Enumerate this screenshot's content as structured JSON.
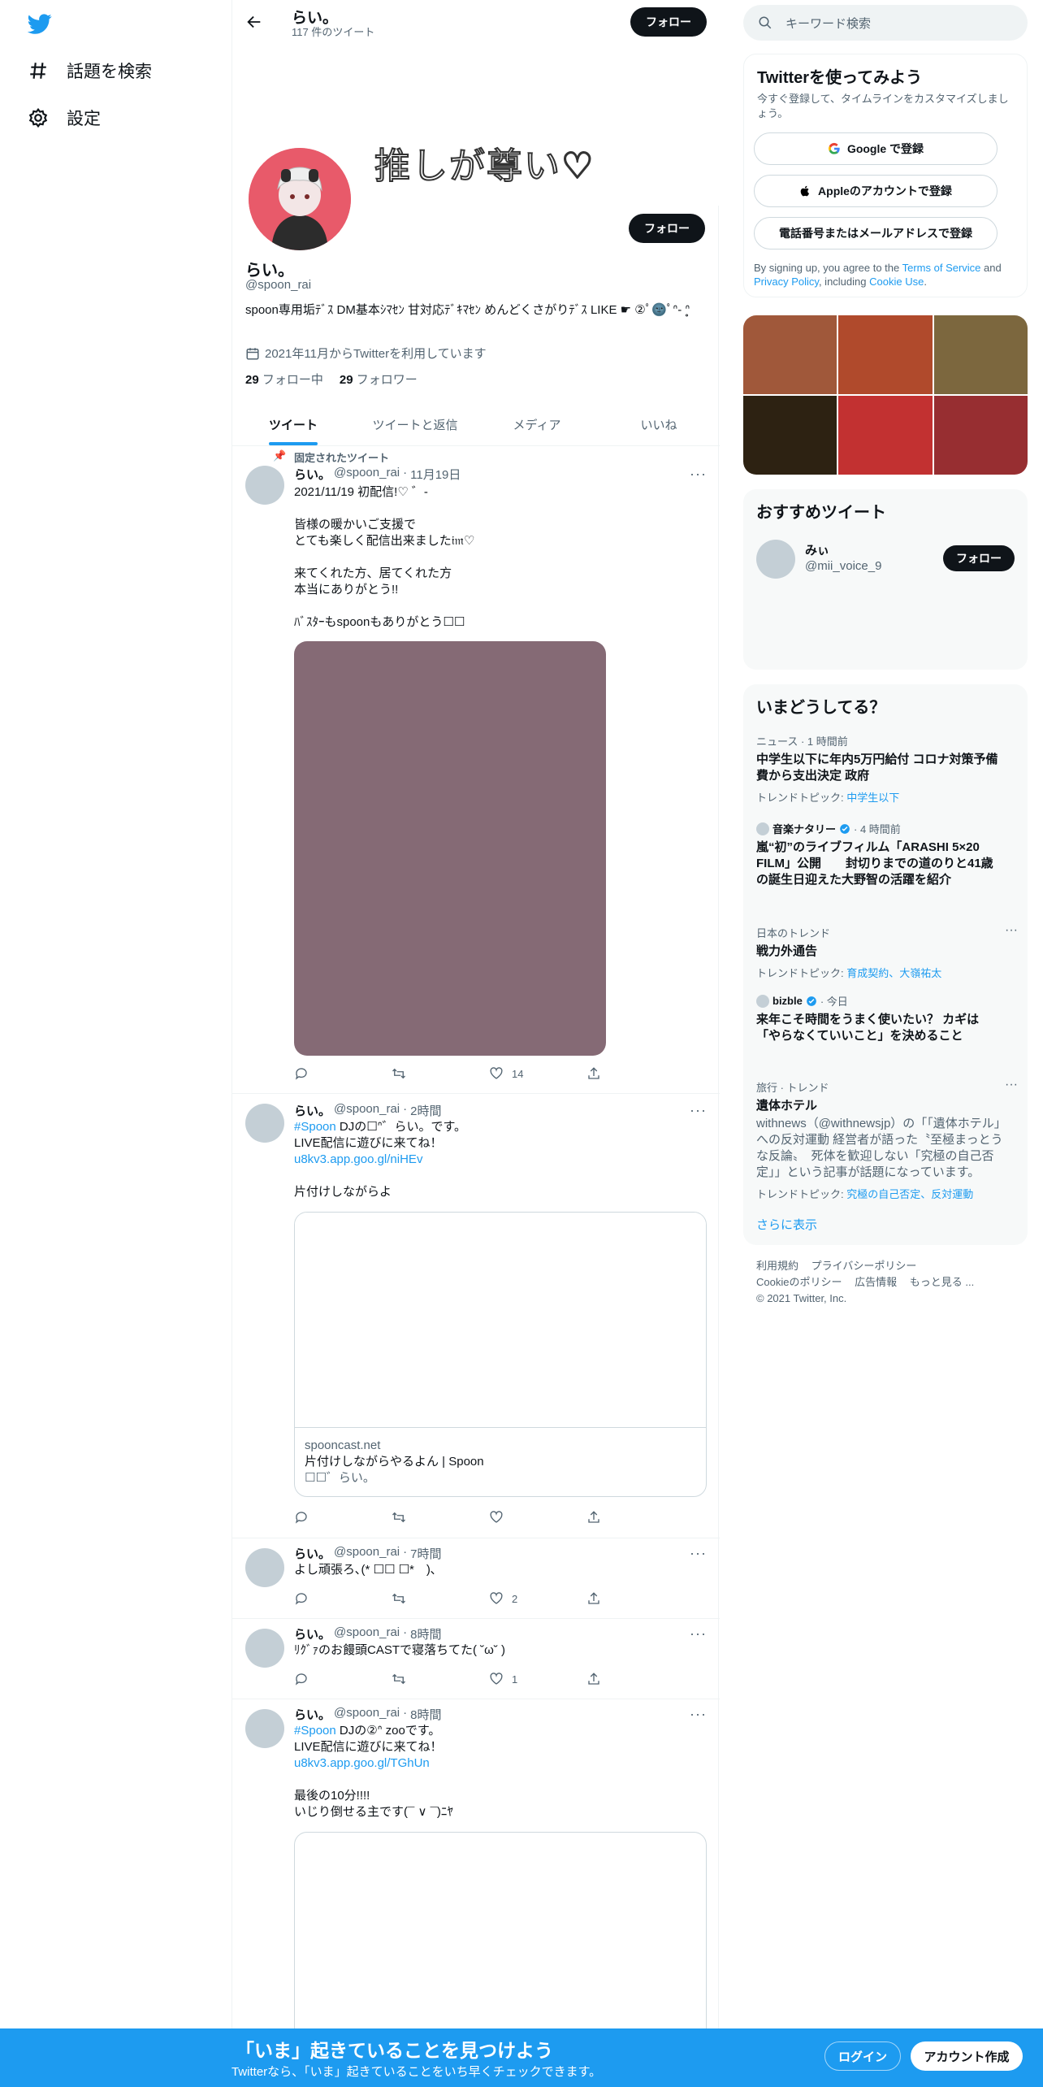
{
  "nav": {
    "explore_label": "話題を検索",
    "settings_label": "設定"
  },
  "header": {
    "name": "らい。",
    "tweet_count": "117 件のツイート",
    "follow_label": "フォロー"
  },
  "profile": {
    "banner_text": "推しが尊い♡",
    "name": "らい。",
    "handle": "@spoon_rai",
    "bio": "spoon専用垢ﾃﾞｽ DM基本ｼﾏｾﾝ 甘対応ﾃﾞｷﾏｾﾝ めんどくさがりﾃﾞｽ LIKE ☛ ②ﾟ🌚ﾟᐢ- ᐢ̥",
    "joined": "2021年11月からTwitterを利用しています",
    "following_count": "29",
    "following_label": "フォロー中",
    "followers_count": "29",
    "followers_label": "フォロワー",
    "follow_label": "フォロー"
  },
  "tabs": [
    "ツイート",
    "ツイートと返信",
    "メディア",
    "いいね"
  ],
  "tweets": [
    {
      "pinned_label": "固定されたツイート",
      "name": "らい。",
      "handle": "@spoon_rai",
      "time": "11月19日",
      "text": "2021/11/19 初配信!♡ ゛-\n\n皆様の暖かいご支援で\nとても楽しく配信出来ました𝔦𝔪♡\n\n来てくれた方、居てくれた方\n本当にありがとう!!\n\nﾊﾞｽﾀｰもspoonもありがとう☐☐",
      "likes": "14"
    },
    {
      "name": "らい。",
      "handle": "@spoon_rai",
      "time": "2時間",
      "hashtag": "#Spoon",
      "text_after_tag": " DJの☐ᐢ゛らい。です。",
      "text2": "LIVE配信に遊びに来てね！",
      "link": "u8kv3.app.goo.gl/niHEv",
      "text3": "片付けしながらよ",
      "card_domain": "spooncast.net",
      "card_title": "片付けしながらやるよん | Spoon",
      "card_desc": "☐☐゛らい。",
      "likes": ""
    },
    {
      "name": "らい。",
      "handle": "@spoon_rai",
      "time": "7時間",
      "text": "よし頑張ろ､(* ☐☐ ☐*　)､",
      "likes": "2"
    },
    {
      "name": "らい。",
      "handle": "@spoon_rai",
      "time": "8時間",
      "text": "ﾘｸﾞｧのお饅頭CASTで寝落ちてた( ˘ω˘ )",
      "likes": "1"
    },
    {
      "name": "らい。",
      "handle": "@spoon_rai",
      "time": "8時間",
      "hashtag": "#Spoon",
      "text_after_tag": " DJの②ᐢ zooです。",
      "text2": "LIVE配信に遊びに来てね！",
      "link": "u8kv3.app.goo.gl/TGhUn",
      "text3": "最後の10分!!!!\nいじり倒せる主です(¯ ∨ ¯)ﾆﾔ"
    }
  ],
  "search": {
    "placeholder": "キーワード検索"
  },
  "signup": {
    "title": "Twitterを使ってみよう",
    "subtitle": "今すぐ登録して、タイムラインをカスタマイズしましょう。",
    "google": "Google で登録",
    "apple": "Appleのアカウントで登録",
    "phone": "電話番号またはメールアドレスで登録",
    "legal_pre": "By signing up, you agree to the ",
    "terms": "Terms of Service",
    "and": " and ",
    "privacy": "Privacy Policy",
    "including": ", including ",
    "cookie": "Cookie Use",
    "period": "."
  },
  "swatches": [
    "#a0583a",
    "#b04a2c",
    "#7c673e",
    "#2d2212",
    "#c23131",
    "#972e31"
  ],
  "recommended": {
    "title": "おすすめツイート",
    "name": "みぃ",
    "handle": "@mii_voice_9",
    "follow_label": "フォロー"
  },
  "trends": {
    "title": "いまどうしてる？",
    "items": [
      {
        "meta": "ニュース · 1 時間前",
        "title": "中学生以下に年内5万円給付 コロナ対策予備費から支出決定 政府",
        "topic_label": "トレンドトピック: ",
        "topic": "中学生以下"
      },
      {
        "source": "音楽ナタリー",
        "meta": " · 4 時間前",
        "title": "嵐“初”のライブフィルム「ARASHI 5×20 FILM」公開　　封切りまでの道のりと41歳の誕生日迎えた大野智の活躍を紹介"
      },
      {
        "meta": "日本のトレンド",
        "title": "戦力外通告",
        "topic_label": "トレンドトピック: ",
        "topic": "育成契約、大嶺祐太"
      },
      {
        "source": "bizble",
        "meta": " · 今日",
        "title": "来年こそ時間をうまく使いたい？ カギは「やらなくていいこと」を決めること"
      },
      {
        "meta": "旅行 · トレンド",
        "title": "遺体ホテル",
        "desc": "withnews（@withnewsjp）の「「遺体ホテル」への反対運動 経営者が語った〝至極まっとうな反論〟　死体を歓迎しない「究極の自己否定」」という記事が話題になっています。",
        "topic_label": "トレンドトピック: ",
        "topic": "究極の自己否定、反対運動"
      }
    ],
    "show_more": "さらに表示"
  },
  "footer": {
    "links1": [
      "利用規約",
      "プライバシーポリシー"
    ],
    "links2": [
      "Cookieのポリシー",
      "広告情報",
      "もっと見る ..."
    ],
    "copyright": "© 2021 Twitter, Inc."
  },
  "bottom": {
    "title": "「いま」起きていることを見つけよう",
    "subtitle": "Twitterなら、「いま」起きていることをいち早くチェックできます。",
    "login": "ログイン",
    "signup": "アカウント作成"
  },
  "colors": {
    "accent": "#1d9bf0",
    "dark": "#0f1419",
    "muted": "#536471"
  }
}
